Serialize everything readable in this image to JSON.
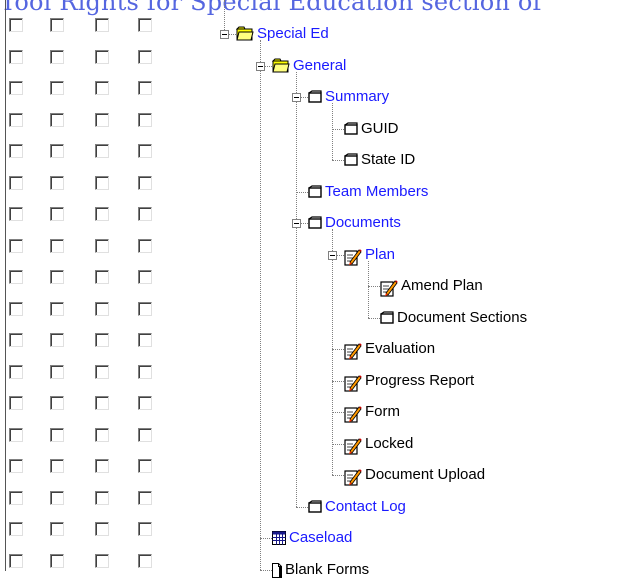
{
  "header": {
    "title": "Tool Rights for Special Education section of"
  },
  "checkbox_grid": {
    "columns": 4,
    "rows": 18
  },
  "tree": {
    "nodes": [
      {
        "label": "Special Ed",
        "icon": "folder-icon",
        "expander": "minus",
        "link": true
      },
      {
        "label": "General",
        "icon": "folder-icon",
        "expander": "minus",
        "link": true
      },
      {
        "label": "Summary",
        "icon": "page-icon",
        "expander": "minus",
        "link": true
      },
      {
        "label": "GUID",
        "icon": "page-icon",
        "expander": "",
        "link": false
      },
      {
        "label": "State ID",
        "icon": "page-icon",
        "expander": "",
        "link": false
      },
      {
        "label": "Team Members",
        "icon": "page-icon",
        "expander": "",
        "link": true
      },
      {
        "label": "Documents",
        "icon": "page-icon",
        "expander": "minus",
        "link": true
      },
      {
        "label": "Plan",
        "icon": "edit-document-icon",
        "expander": "minus",
        "link": true
      },
      {
        "label": "Amend Plan",
        "icon": "edit-document-icon",
        "expander": "",
        "link": false
      },
      {
        "label": "Document Sections",
        "icon": "page-icon",
        "expander": "",
        "link": false
      },
      {
        "label": "Evaluation",
        "icon": "edit-document-icon",
        "expander": "",
        "link": false
      },
      {
        "label": "Progress Report",
        "icon": "edit-document-icon",
        "expander": "",
        "link": false
      },
      {
        "label": "Form",
        "icon": "edit-document-icon",
        "expander": "",
        "link": false
      },
      {
        "label": "Locked",
        "icon": "edit-document-icon",
        "expander": "",
        "link": false
      },
      {
        "label": "Document Upload",
        "icon": "edit-document-icon",
        "expander": "",
        "link": false
      },
      {
        "label": "Contact Log",
        "icon": "page-icon",
        "expander": "",
        "link": true
      },
      {
        "label": "Caseload",
        "icon": "calendar-grid-icon",
        "expander": "",
        "link": true
      },
      {
        "label": "Blank Forms",
        "icon": "blank-document-icon",
        "expander": "",
        "link": false
      }
    ]
  }
}
